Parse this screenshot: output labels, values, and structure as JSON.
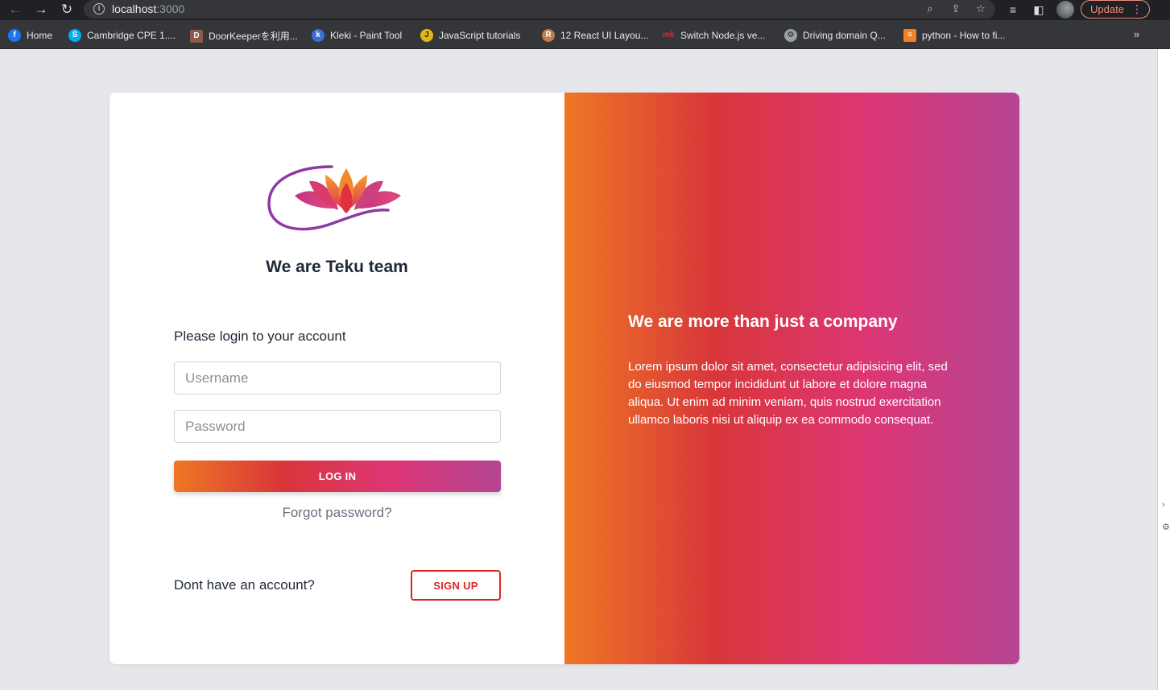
{
  "browser": {
    "url_host": "localhost",
    "url_port": ":3000",
    "update_label": "Update",
    "bookmarks": [
      {
        "label": "Home",
        "icon": "facebook-icon",
        "color": "#1877f2"
      },
      {
        "label": "Cambridge CPE 1....",
        "icon": "skype-icon",
        "color": "#00aff0"
      },
      {
        "label": "DoorKeeperを利用...",
        "icon": "doorkeeper-icon",
        "color": "#8b5a4a"
      },
      {
        "label": "Kleki - Paint Tool",
        "icon": "kleki-icon",
        "color": "#3b6fd8"
      },
      {
        "label": "JavaScript tutorials",
        "icon": "javascript-icon",
        "color": "#e2b714"
      },
      {
        "label": "12 React UI Layou...",
        "icon": "react-layout-icon",
        "color": "#c27c4a"
      },
      {
        "label": "Switch Node.js ve...",
        "icon": "mk-icon",
        "color": "#d32f2f"
      },
      {
        "label": "Driving domain Q...",
        "icon": "gear-icon",
        "color": "#9aa0a6"
      },
      {
        "label": "python - How to fi...",
        "icon": "stackoverflow-icon",
        "color": "#f48024"
      }
    ],
    "bookmarks_more": "»"
  },
  "login": {
    "team_title": "We are Teku team",
    "prompt": "Please login to your account",
    "username_placeholder": "Username",
    "password_placeholder": "Password",
    "login_label": "LOG IN",
    "forgot_label": "Forgot password?",
    "no_account_text": "Dont have an account?",
    "signup_label": "SIGN UP"
  },
  "promo": {
    "title": "We are more than just a company",
    "text": "Lorem ipsum dolor sit amet, consectetur adipisicing elit, sed do eiusmod tempor incididunt ut labore et dolore magna aliqua. Ut enim ad minim veniam, quis nostrud exercitation ullamco laboris nisi ut aliquip ex ea commodo consequat."
  },
  "colors": {
    "gradient": [
      "#ee7724",
      "#d8363a",
      "#dd3675",
      "#b44593"
    ],
    "signup_accent": "#dc2626",
    "page_background": "#e5e7eb"
  }
}
